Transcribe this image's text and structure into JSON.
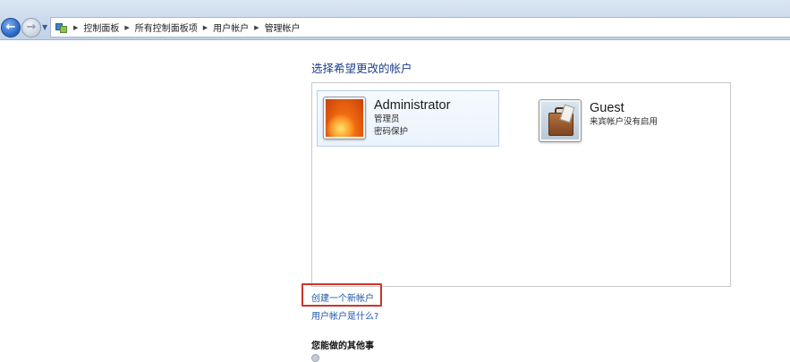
{
  "breadcrumb": {
    "items": [
      "控制面板",
      "所有控制面板项",
      "用户帐户",
      "管理帐户"
    ]
  },
  "main": {
    "title": "选择希望更改的帐户",
    "accounts": [
      {
        "name": "Administrator",
        "lines": [
          "管理员",
          "密码保护"
        ],
        "icon": "orange-flower-avatar",
        "selected": true
      },
      {
        "name": "Guest",
        "lines": [
          "来宾帐户没有启用"
        ],
        "icon": "suitcase-avatar",
        "selected": false
      }
    ],
    "links": {
      "create_account": "创建一个新帐户",
      "what_is_account": "用户帐户是什么?"
    },
    "other_tasks_title": "您能做的其他事"
  },
  "colors": {
    "link": "#1e56a8",
    "heading": "#1e3f8a",
    "highlight_box": "#c8352a"
  }
}
